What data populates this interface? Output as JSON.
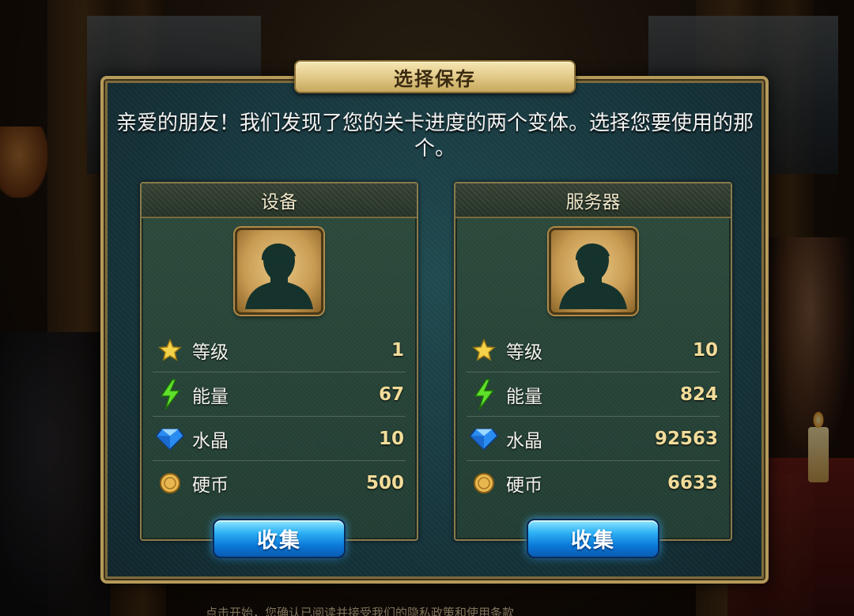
{
  "dialog": {
    "title": "选择保存",
    "message": "亲爱的朋友！我们发现了您的关卡进度的两个变体。选择您要使用的那个。"
  },
  "panels": [
    {
      "title": "设备",
      "stats": [
        {
          "label": "等级",
          "value": "1"
        },
        {
          "label": "能量",
          "value": "67"
        },
        {
          "label": "水晶",
          "value": "10"
        },
        {
          "label": "硬币",
          "value": "500"
        }
      ],
      "button": "收集"
    },
    {
      "title": "服务器",
      "stats": [
        {
          "label": "等级",
          "value": "10"
        },
        {
          "label": "能量",
          "value": "824"
        },
        {
          "label": "水晶",
          "value": "92563"
        },
        {
          "label": "硬币",
          "value": "6633"
        }
      ],
      "button": "收集"
    }
  ],
  "footer": {
    "text": "点击开始，您确认已阅读并接受我们的隐私政策和使用条款"
  },
  "colors": {
    "gold": "#f2dc9a",
    "panel_bg": "#223d33",
    "button_blue": "#0b78d8",
    "title_plate": "#e4cd8c"
  },
  "icons": [
    "star-icon",
    "lightning-icon",
    "crystal-icon",
    "coin-icon",
    "avatar-silhouette-icon"
  ]
}
